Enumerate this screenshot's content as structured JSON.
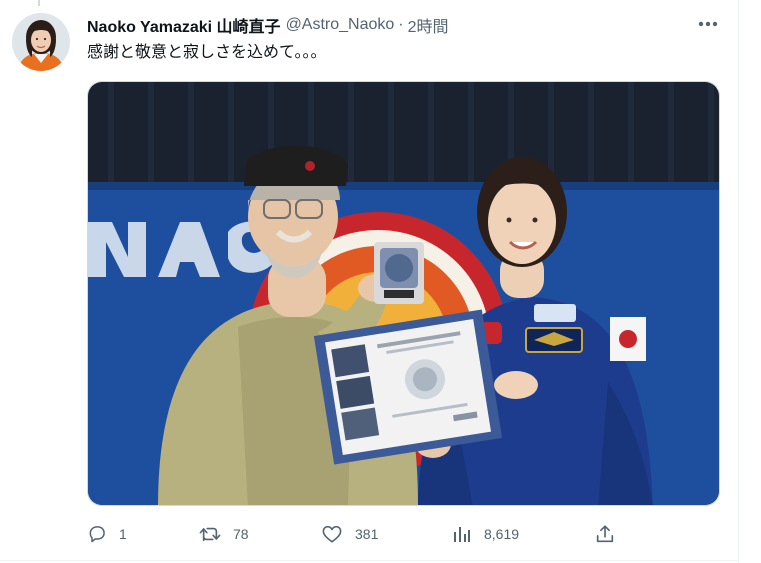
{
  "author": {
    "display_name": "Naoko Yamazaki 山崎直子",
    "handle": "@Astro_Naoko",
    "separator": "·",
    "time": "2時間"
  },
  "tweet": {
    "text": "感謝と敬意と寂しさを込めて。。。"
  },
  "actions": {
    "reply_count": "1",
    "retweet_count": "78",
    "like_count": "381",
    "view_count": "8,619"
  },
  "colors": {
    "text_primary": "#0f1419",
    "text_secondary": "#536471",
    "divider": "#eff3f4"
  },
  "icons": {
    "more": "more-horizontal-icon",
    "reply": "reply-icon",
    "retweet": "retweet-icon",
    "like": "heart-icon",
    "views": "views-bar-chart-icon",
    "share": "share-icon"
  }
}
